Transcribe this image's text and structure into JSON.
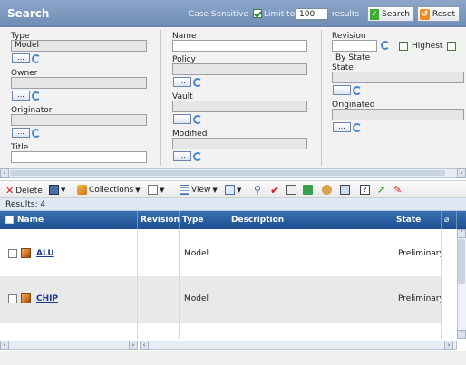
{
  "header": {
    "title": "Search",
    "case_sensitive": "Case Sensitive",
    "limit_to": "Limit to",
    "limit_value": "100",
    "results_word": "results",
    "search_btn": "Search",
    "reset_btn": "Reset"
  },
  "form": {
    "type_label": "Type",
    "type_value": "Model",
    "owner_label": "Owner",
    "originator_label": "Originator",
    "title_label": "Title",
    "name_label": "Name",
    "policy_label": "Policy",
    "vault_label": "Vault",
    "modified_label": "Modified",
    "revision_label": "Revision",
    "highest_label": "Highest",
    "by_state_label": "By State",
    "state_label": "State",
    "originated_label": "Originated",
    "dots": "..."
  },
  "toolbar": {
    "delete": "Delete",
    "collections": "Collections",
    "view": "View"
  },
  "results_count": "Results: 4",
  "table": {
    "columns": [
      "Name",
      "Revision",
      "Type",
      "Description",
      "State"
    ],
    "rows": [
      {
        "name": "ALU",
        "revision": "",
        "type": "Model",
        "description": "",
        "state": "Preliminary"
      },
      {
        "name": "CHIP",
        "revision": "",
        "type": "Model",
        "description": "",
        "state": "Preliminary"
      }
    ]
  }
}
